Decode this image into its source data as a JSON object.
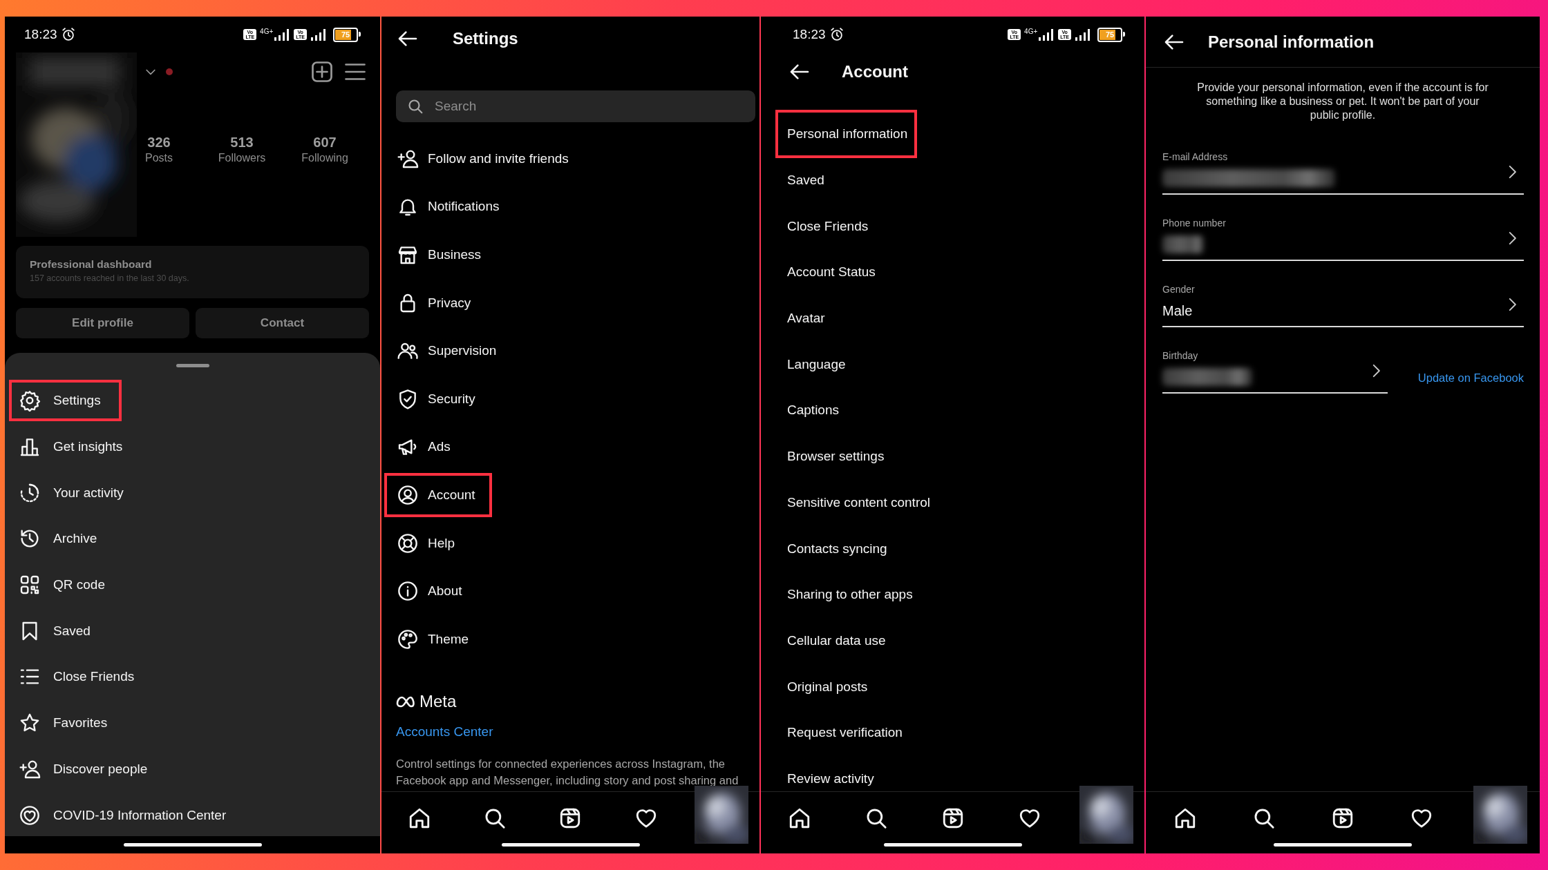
{
  "profile_screen": {
    "status_bar": {
      "time": "18:23",
      "sim_badges": [
        {
          "top": "Vo",
          "bottom": "LTE"
        },
        {
          "top": "Vo",
          "bottom": "LTE"
        }
      ],
      "network": "4G+",
      "battery": "75"
    },
    "stats": [
      {
        "value": "326",
        "label": "Posts"
      },
      {
        "value": "513",
        "label": "Followers"
      },
      {
        "value": "607",
        "label": "Following"
      }
    ],
    "dashboard": {
      "title": "Professional dashboard",
      "subtitle": "157 accounts reached in the last 30 days."
    },
    "buttons": [
      "Edit profile",
      "Contact"
    ],
    "menu": [
      {
        "label": "Settings",
        "highlighted": true
      },
      {
        "label": "Get insights",
        "highlighted": false
      },
      {
        "label": "Your activity",
        "highlighted": false
      },
      {
        "label": "Archive",
        "highlighted": false
      },
      {
        "label": "QR code",
        "highlighted": false
      },
      {
        "label": "Saved",
        "highlighted": false
      },
      {
        "label": "Close Friends",
        "highlighted": false
      },
      {
        "label": "Favorites",
        "highlighted": false
      },
      {
        "label": "Discover people",
        "highlighted": false
      },
      {
        "label": "COVID-19 Information Center",
        "highlighted": false
      }
    ]
  },
  "settings_screen": {
    "title": "Settings",
    "search": {
      "placeholder": "Search"
    },
    "items": [
      {
        "label": "Follow and invite friends",
        "highlighted": false
      },
      {
        "label": "Notifications",
        "highlighted": false
      },
      {
        "label": "Business",
        "highlighted": false
      },
      {
        "label": "Privacy",
        "highlighted": false
      },
      {
        "label": "Supervision",
        "highlighted": false
      },
      {
        "label": "Security",
        "highlighted": false
      },
      {
        "label": "Ads",
        "highlighted": false
      },
      {
        "label": "Account",
        "highlighted": true
      },
      {
        "label": "Help",
        "highlighted": false
      },
      {
        "label": "About",
        "highlighted": false
      },
      {
        "label": "Theme",
        "highlighted": false
      }
    ],
    "brand": "Meta",
    "accounts_link": "Accounts Center",
    "description": "Control settings for connected experiences across Instagram, the Facebook app and Messenger, including story and post sharing and"
  },
  "account_screen": {
    "status_bar": {
      "time": "18:23",
      "sim_badges": [
        {
          "top": "Vo",
          "bottom": "LTE"
        },
        {
          "top": "Vo",
          "bottom": "LTE"
        }
      ],
      "network": "4G+",
      "battery": "75"
    },
    "title": "Account",
    "items": [
      {
        "label": "Personal information",
        "highlighted": true
      },
      {
        "label": "Saved",
        "highlighted": false
      },
      {
        "label": "Close Friends",
        "highlighted": false
      },
      {
        "label": "Account Status",
        "highlighted": false
      },
      {
        "label": "Avatar",
        "highlighted": false
      },
      {
        "label": "Language",
        "highlighted": false
      },
      {
        "label": "Captions",
        "highlighted": false
      },
      {
        "label": "Browser settings",
        "highlighted": false
      },
      {
        "label": "Sensitive content control",
        "highlighted": false
      },
      {
        "label": "Contacts syncing",
        "highlighted": false
      },
      {
        "label": "Sharing to other apps",
        "highlighted": false
      },
      {
        "label": "Cellular data use",
        "highlighted": false
      },
      {
        "label": "Original posts",
        "highlighted": false
      },
      {
        "label": "Request verification",
        "highlighted": false
      },
      {
        "label": "Review activity",
        "highlighted": false
      }
    ]
  },
  "personal_info_screen": {
    "title": "Personal information",
    "description": "Provide your personal information, even if the account is for something like a business or pet. It won't be part of your public profile.",
    "fields": [
      {
        "label": "E-mail Address"
      },
      {
        "label": "Phone number"
      },
      {
        "label": "Gender",
        "value": "Male"
      },
      {
        "label": "Birthday",
        "link": "Update on Facebook"
      }
    ]
  }
}
